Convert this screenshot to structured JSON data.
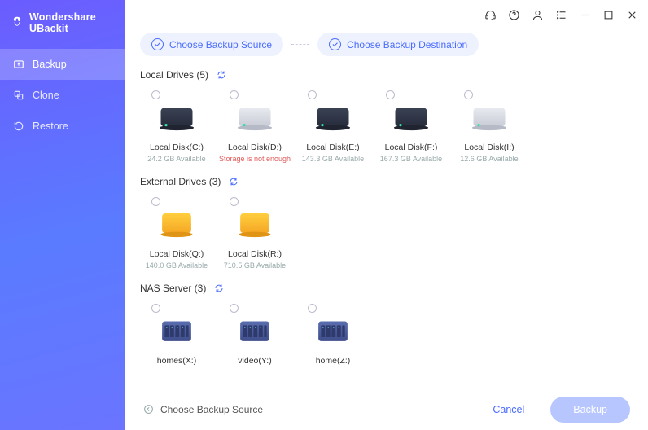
{
  "app": {
    "title": "Wondershare UBackit"
  },
  "sidebar": {
    "items": [
      {
        "label": "Backup"
      },
      {
        "label": "Clone"
      },
      {
        "label": "Restore"
      }
    ]
  },
  "topbar": {
    "icons": [
      "headset",
      "help",
      "user",
      "list",
      "minimize",
      "maximize",
      "close"
    ]
  },
  "steps": {
    "source": "Choose Backup Source",
    "destination": "Choose Backup Destination"
  },
  "sections": {
    "local": {
      "title": "Local Drives (5)",
      "drives": [
        {
          "label": "Local Disk(C:)",
          "sub": "24.2 GB Available",
          "kind": "hdd-dark"
        },
        {
          "label": "Local Disk(D:)",
          "sub": "Storage is not enough",
          "warn": true,
          "kind": "hdd-light"
        },
        {
          "label": "Local Disk(E:)",
          "sub": "143.3 GB Available",
          "kind": "hdd-dark"
        },
        {
          "label": "Local Disk(F:)",
          "sub": "167.3 GB Available",
          "kind": "hdd-dark"
        },
        {
          "label": "Local Disk(I:)",
          "sub": "12.6 GB Available",
          "kind": "hdd-light"
        }
      ]
    },
    "external": {
      "title": "External Drives (3)",
      "drives": [
        {
          "label": "Local Disk(Q:)",
          "sub": "140.0 GB Available",
          "kind": "ext"
        },
        {
          "label": "Local Disk(R:)",
          "sub": "710.5 GB Available",
          "kind": "ext"
        }
      ]
    },
    "nas": {
      "title": "NAS Server (3)",
      "drives": [
        {
          "label": "homes(X:)",
          "sub": "",
          "kind": "nas"
        },
        {
          "label": "video(Y:)",
          "sub": "",
          "kind": "nas"
        },
        {
          "label": "home(Z:)",
          "sub": "",
          "kind": "nas"
        }
      ]
    }
  },
  "footer": {
    "hint": "Choose Backup Source",
    "cancel": "Cancel",
    "primary": "Backup"
  }
}
